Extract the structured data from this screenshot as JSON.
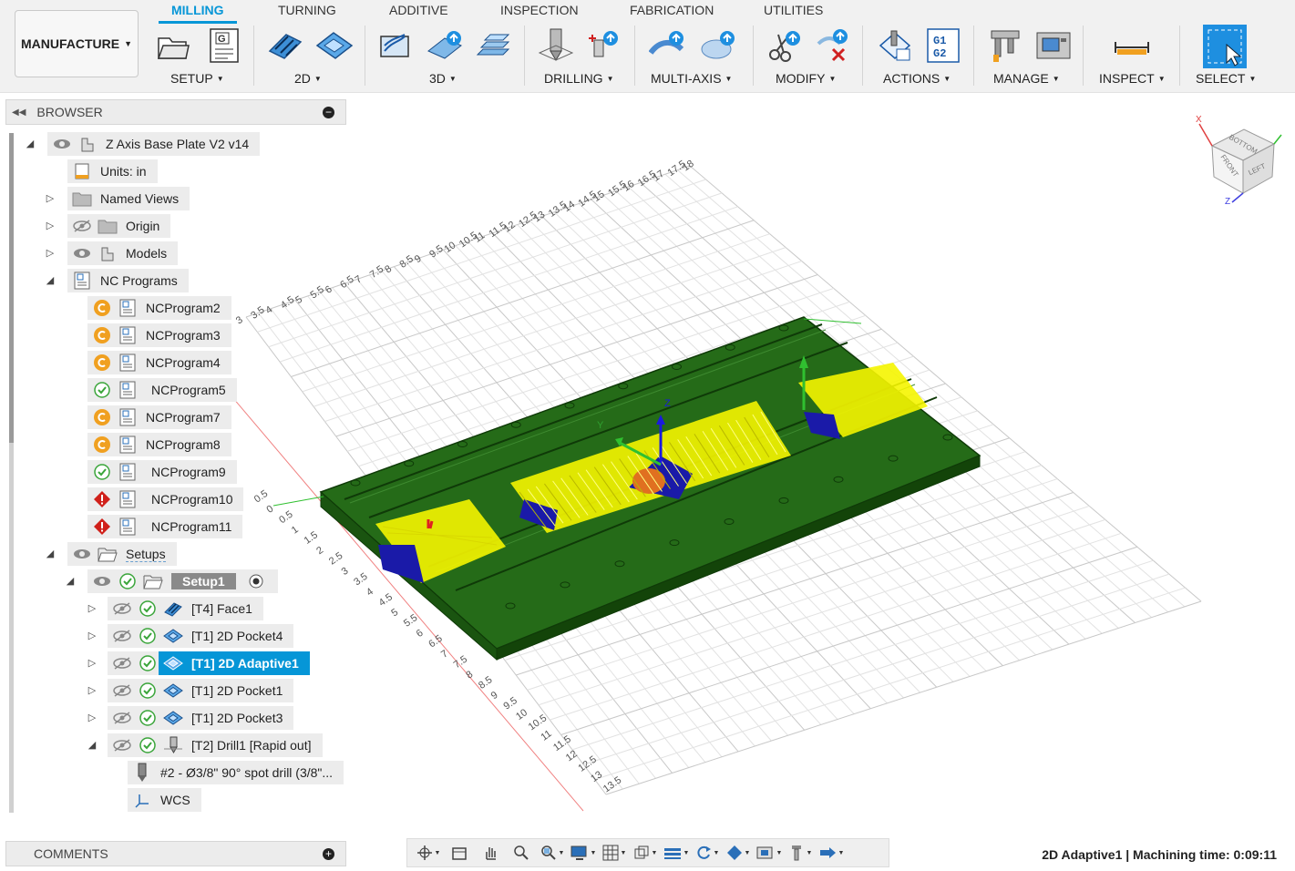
{
  "workspace": {
    "label": "MANUFACTURE"
  },
  "tabs": [
    {
      "label": "MILLING",
      "active": true
    },
    {
      "label": "TURNING"
    },
    {
      "label": "ADDITIVE"
    },
    {
      "label": "INSPECTION"
    },
    {
      "label": "FABRICATION"
    },
    {
      "label": "UTILITIES"
    }
  ],
  "groups": [
    {
      "label": "SETUP"
    },
    {
      "label": "2D"
    },
    {
      "label": "3D"
    },
    {
      "label": "DRILLING"
    },
    {
      "label": "MULTI-AXIS"
    },
    {
      "label": "MODIFY"
    },
    {
      "label": "ACTIONS"
    },
    {
      "label": "MANAGE"
    },
    {
      "label": "INSPECT"
    },
    {
      "label": "SELECT"
    }
  ],
  "toolbar_icons": {
    "gcode_icon_text": [
      "G1",
      "G2"
    ],
    "g_badge": "G"
  },
  "browser": {
    "title": "BROWSER",
    "root": "Z Axis Base Plate V2 v14",
    "units": "Units: in",
    "named_views": "Named Views",
    "origin": "Origin",
    "models": "Models",
    "nc_programs": "NC Programs",
    "programs": [
      {
        "label": "NCProgram2",
        "status": "warning"
      },
      {
        "label": "NCProgram3",
        "status": "warning"
      },
      {
        "label": "NCProgram4",
        "status": "warning"
      },
      {
        "label": "NCProgram5",
        "status": "ok"
      },
      {
        "label": "NCProgram7",
        "status": "warning"
      },
      {
        "label": "NCProgram8",
        "status": "warning"
      },
      {
        "label": "NCProgram9",
        "status": "ok"
      },
      {
        "label": "NCProgram10",
        "status": "error"
      },
      {
        "label": "NCProgram11",
        "status": "error"
      }
    ],
    "setups": "Setups",
    "setup1": "Setup1",
    "operations": [
      {
        "label": "[T4] Face1",
        "icon": "face-icon"
      },
      {
        "label": "[T1] 2D Pocket4",
        "icon": "pocket-icon"
      },
      {
        "label": "[T1] 2D Adaptive1",
        "icon": "adaptive-icon",
        "selected": true
      },
      {
        "label": "[T1] 2D Pocket1",
        "icon": "pocket-icon"
      },
      {
        "label": "[T1] 2D Pocket3",
        "icon": "pocket-icon"
      },
      {
        "label": "[T2] Drill1 [Rapid out]",
        "icon": "drill-icon",
        "expanded": true
      }
    ],
    "tool": "#2 - Ø3/8\" 90° spot drill (3/8\"...",
    "wcs": "WCS"
  },
  "comments": {
    "title": "COMMENTS"
  },
  "status": {
    "text": "2D Adaptive1 | Machining time: 0:09:11"
  },
  "viewcube": {
    "faces": [
      "BOTTOM",
      "LEFT",
      "FRONT"
    ],
    "axes": [
      "X",
      "Z"
    ]
  },
  "axis_labels": {
    "x": "X",
    "y": "Y",
    "z": "Z"
  },
  "grid_ticks": {
    "back_edge": [
      "3",
      "3.5",
      "4",
      "4.5",
      "5",
      "5.5",
      "6",
      "6.5",
      "7",
      "7.5",
      "8",
      "8.5",
      "9",
      "9.5",
      "10",
      "10.5",
      "11",
      "11.5",
      "12",
      "12.5",
      "13",
      "13.5",
      "14",
      "14.5",
      "15",
      "15.5",
      "16",
      "16.5",
      "17",
      "17.5",
      "18"
    ],
    "front_edge": [
      "0.5",
      "0",
      "0.5",
      "1",
      "1.5",
      "2",
      "2.5",
      "3",
      "3.5",
      "4",
      "4.5",
      "5",
      "5.5",
      "6",
      "6.5",
      "7",
      "7.5",
      "8",
      "8.5",
      "9",
      "9.5",
      "10",
      "10.5",
      "11",
      "11.5",
      "12",
      "12.5",
      "13",
      "13.5"
    ]
  },
  "colors": {
    "accent": "#0696d7",
    "part": "#1e5a14",
    "toolpath": "#f5f500",
    "stock_blue": "#1a1aa8",
    "warning": "#f0a020",
    "ok": "#3aa53a",
    "error": "#d0201a"
  }
}
